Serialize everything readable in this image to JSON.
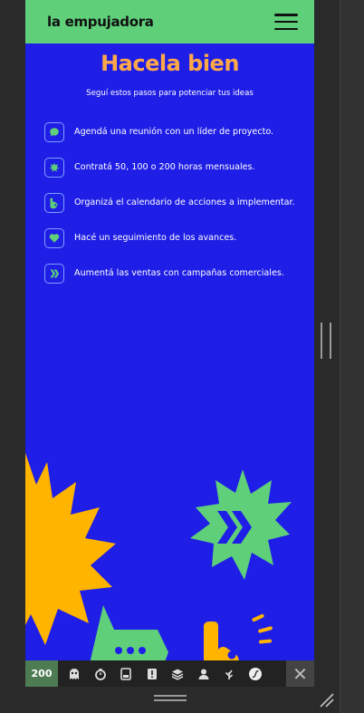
{
  "header": {
    "logo": "la empujadora",
    "menu_icon": "hamburger-menu-icon"
  },
  "hero": {
    "title": "Hacela bien",
    "subtitle": "Seguí estos pasos para potenciar tus ideas"
  },
  "steps": [
    {
      "icon": "chat-bubble-icon",
      "text": "Agendá una reunión con un líder de proyecto."
    },
    {
      "icon": "star-burst-icon",
      "text": "Contratá 50, 100 o 200 horas mensuales."
    },
    {
      "icon": "ok-hand-icon",
      "text": "Organizá el calendario de acciones a implementar."
    },
    {
      "icon": "heart-icon",
      "text": "Hacé un seguimiento de los avances."
    },
    {
      "icon": "double-chevron-icon",
      "text": "Aumentá las ventas con campañas comerciales."
    }
  ],
  "colors": {
    "background": "#1e1ee6",
    "header": "#5fcf7a",
    "title": "#ffa84a",
    "accent_green": "#5fcf7a",
    "accent_orange": "#ffb400"
  },
  "devbar": {
    "status": "200",
    "tools": [
      "ghost-icon",
      "timer-icon",
      "database-icon",
      "alert-icon",
      "layers-icon",
      "user-icon",
      "wheat-icon",
      "symfony-icon"
    ],
    "close_label": "✕"
  }
}
